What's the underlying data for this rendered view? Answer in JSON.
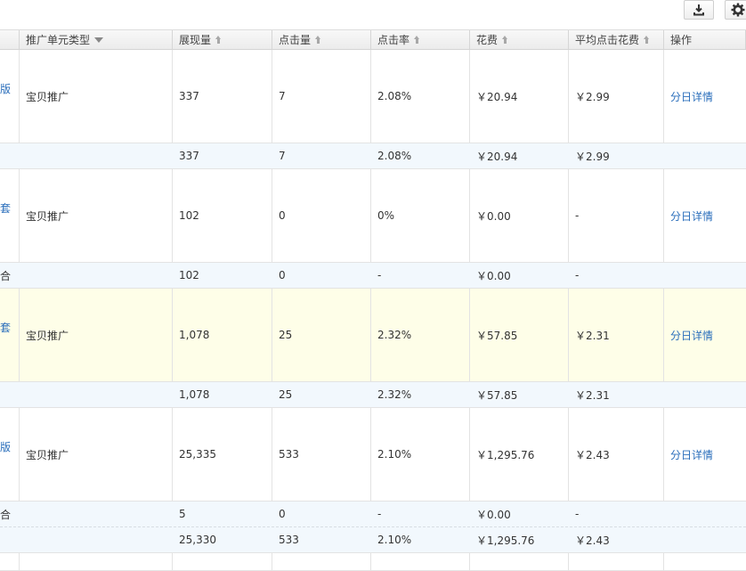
{
  "toolbar": {
    "download_icon": "download-icon",
    "settings_icon": "gear-icon"
  },
  "header": {
    "col_unit_type": "推广单元类型",
    "col_impressions": "展现量",
    "col_clicks": "点击量",
    "col_ctr": "点击率",
    "col_cost": "花费",
    "col_avg_cpc": "平均点击花费",
    "col_actions": "操作"
  },
  "rows": [
    {
      "cut_text": "版",
      "unit_type": "宝贝推广",
      "impressions": "337",
      "clicks": "7",
      "ctr": "2.08%",
      "cost": "￥20.94",
      "avg_cpc": "￥2.99",
      "action": "分日详情",
      "summary": {
        "cut_text": "",
        "impressions": "337",
        "clicks": "7",
        "ctr": "2.08%",
        "cost": "￥20.94",
        "avg_cpc": "￥2.99"
      }
    },
    {
      "cut_text": "套",
      "unit_type": "宝贝推广",
      "impressions": "102",
      "clicks": "0",
      "ctr": "0%",
      "cost": "￥0.00",
      "avg_cpc": "-",
      "action": "分日详情",
      "summary": {
        "cut_text": "合",
        "impressions": "102",
        "clicks": "0",
        "ctr": "-",
        "cost": "￥0.00",
        "avg_cpc": "-"
      }
    },
    {
      "cut_text": "套",
      "unit_type": "宝贝推广",
      "impressions": "1,078",
      "clicks": "25",
      "ctr": "2.32%",
      "cost": "￥57.85",
      "avg_cpc": "￥2.31",
      "action": "分日详情",
      "summary": {
        "cut_text": "",
        "impressions": "1,078",
        "clicks": "25",
        "ctr": "2.32%",
        "cost": "￥57.85",
        "avg_cpc": "￥2.31"
      }
    },
    {
      "cut_text": "版",
      "unit_type": "宝贝推广",
      "impressions": "25,335",
      "clicks": "533",
      "ctr": "2.10%",
      "cost": "￥1,295.76",
      "avg_cpc": "￥2.43",
      "action": "分日详情",
      "summary": {
        "cut_text": "合",
        "impressions": "5",
        "clicks": "0",
        "ctr": "-",
        "cost": "￥0.00",
        "avg_cpc": "-"
      },
      "summary2": {
        "impressions": "25,330",
        "clicks": "533",
        "ctr": "2.10%",
        "cost": "￥1,295.76",
        "avg_cpc": "￥2.43"
      }
    }
  ],
  "colors": {
    "link": "#2a6ebb",
    "highlight_row": "#fefee8",
    "summary_row": "#f2f8fd"
  }
}
